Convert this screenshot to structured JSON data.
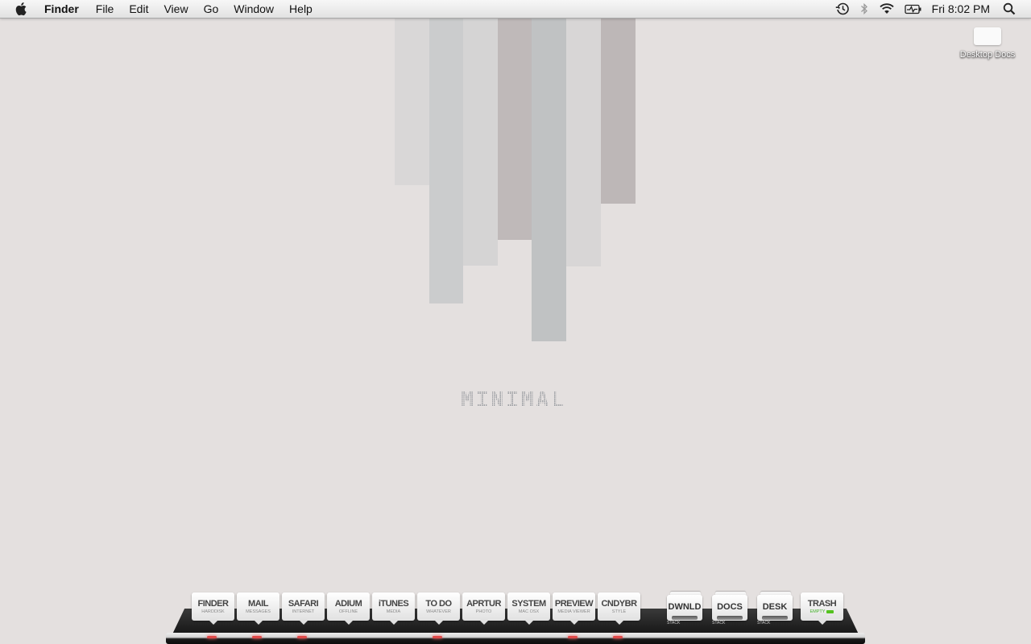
{
  "menubar": {
    "apple_icon": "apple-icon",
    "app_name": "Finder",
    "menus": [
      "File",
      "Edit",
      "View",
      "Go",
      "Window",
      "Help"
    ],
    "status_icons": [
      "time-machine-icon",
      "bluetooth-icon",
      "wifi-icon",
      "battery-icon"
    ],
    "clock": "Fri 8:02 PM",
    "spotlight_icon": "spotlight-icon"
  },
  "wallpaper": {
    "wordmark": "MINIMAL",
    "bar_colors": [
      "#d9d7d7",
      "#cbcccd",
      "#d5d4d4",
      "#bfb9b9",
      "#c0c2c3",
      "#d8d6d6",
      "#bdb7b7"
    ]
  },
  "desktop": {
    "icons": [
      {
        "label": "Desktop Docs"
      }
    ]
  },
  "dock": {
    "apps": [
      {
        "name": "FINDER",
        "sub": "HARDDISK",
        "running": true
      },
      {
        "name": "MAIL",
        "sub": "MESSAGES",
        "running": true
      },
      {
        "name": "SAFARI",
        "sub": "INTERNET",
        "running": true
      },
      {
        "name": "ADIUM",
        "sub": "OFFLINE",
        "running": false
      },
      {
        "name": "iTUNES",
        "sub": "MEDIA",
        "running": false
      },
      {
        "name": "TO DO",
        "sub": "WHATEVER",
        "running": true
      },
      {
        "name": "APRTUR",
        "sub": "PHOTO",
        "running": false
      },
      {
        "name": "SYSTEM",
        "sub": "MAC OSX",
        "running": false
      },
      {
        "name": "PREVIEW",
        "sub": "MEDIA VIEWER",
        "running": true
      },
      {
        "name": "CNDYBR",
        "sub": "STYLE",
        "running": true
      }
    ],
    "stacks": [
      {
        "name": "DWNLD",
        "label": "STACK"
      },
      {
        "name": "DOCS",
        "label": "STACK"
      },
      {
        "name": "DESK",
        "label": "STACK"
      }
    ],
    "trash": {
      "name": "TRASH",
      "sub": "EMPTY",
      "accent": "#54c21f"
    },
    "running_indicator_color": "#e04848"
  }
}
